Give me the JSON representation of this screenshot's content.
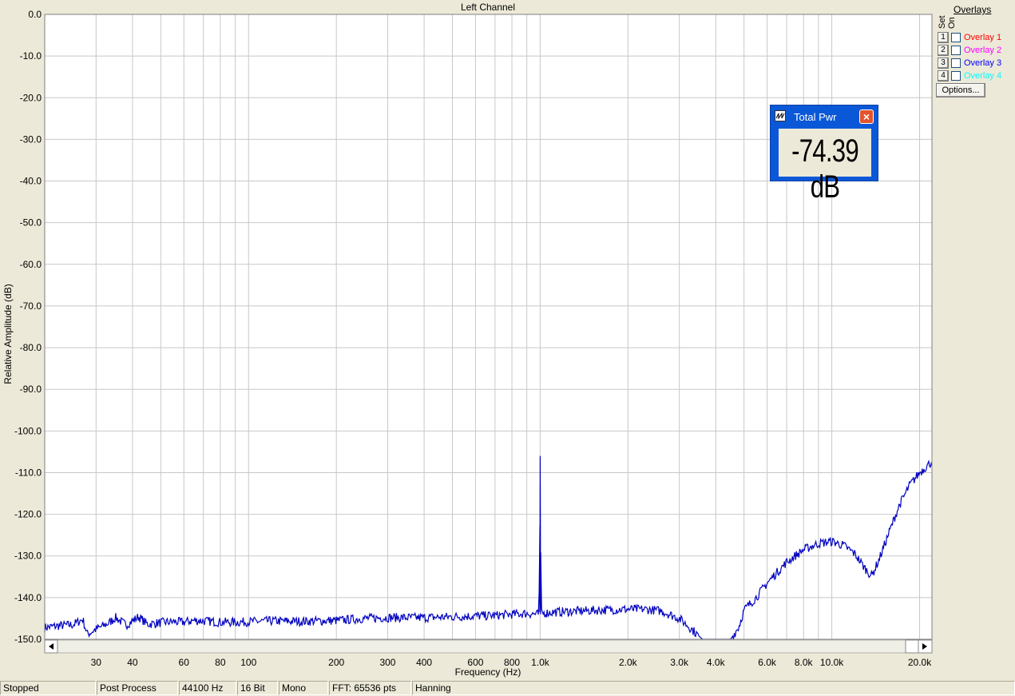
{
  "chart_data": {
    "type": "line",
    "title": "Left Channel",
    "xlabel": "Frequency (Hz)",
    "ylabel": "Relative Amplitude (dB)",
    "xscale": "log",
    "xlim": [
      20,
      22050
    ],
    "ylim": [
      -150,
      0
    ],
    "grid": true,
    "line_color": "#0000c0",
    "x_ticks": [
      {
        "v": 30,
        "label": "30"
      },
      {
        "v": 40,
        "label": "40"
      },
      {
        "v": 60,
        "label": "60"
      },
      {
        "v": 80,
        "label": "80"
      },
      {
        "v": 100,
        "label": "100"
      },
      {
        "v": 200,
        "label": "200"
      },
      {
        "v": 300,
        "label": "300"
      },
      {
        "v": 400,
        "label": "400"
      },
      {
        "v": 600,
        "label": "600"
      },
      {
        "v": 800,
        "label": "800"
      },
      {
        "v": 1000,
        "label": "1.0k"
      },
      {
        "v": 2000,
        "label": "2.0k"
      },
      {
        "v": 3000,
        "label": "3.0k"
      },
      {
        "v": 4000,
        "label": "4.0k"
      },
      {
        "v": 6000,
        "label": "6.0k"
      },
      {
        "v": 8000,
        "label": "8.0k"
      },
      {
        "v": 10000,
        "label": "10.0k"
      },
      {
        "v": 20000,
        "label": "20.0k"
      }
    ],
    "y_ticks": [
      {
        "v": 0,
        "label": "0.0"
      },
      {
        "v": -10,
        "label": "-10.0"
      },
      {
        "v": -20,
        "label": "-20.0"
      },
      {
        "v": -30,
        "label": "-30.0"
      },
      {
        "v": -40,
        "label": "-40.0"
      },
      {
        "v": -50,
        "label": "-50.0"
      },
      {
        "v": -60,
        "label": "-60.0"
      },
      {
        "v": -70,
        "label": "-70.0"
      },
      {
        "v": -80,
        "label": "-80.0"
      },
      {
        "v": -90,
        "label": "-90.0"
      },
      {
        "v": -100,
        "label": "-100.0"
      },
      {
        "v": -110,
        "label": "-110.0"
      },
      {
        "v": -120,
        "label": "-120.0"
      },
      {
        "v": -130,
        "label": "-130.0"
      },
      {
        "v": -140,
        "label": "-140.0"
      },
      {
        "v": -150,
        "label": "-150.0"
      }
    ],
    "series": [
      {
        "points": [
          [
            20,
            -147.2
          ],
          [
            22,
            -146.8
          ],
          [
            25,
            -146.5
          ],
          [
            27,
            -145.2
          ],
          [
            28,
            -148.8
          ],
          [
            30,
            -147.6
          ],
          [
            33,
            -146.2
          ],
          [
            35,
            -144.8
          ],
          [
            38,
            -146.6
          ],
          [
            40,
            -145.6
          ],
          [
            42,
            -144.6
          ],
          [
            45,
            -146.4
          ],
          [
            50,
            -146.0
          ],
          [
            55,
            -145.8
          ],
          [
            60,
            -145.9
          ],
          [
            65,
            -145.5
          ],
          [
            70,
            -145.6
          ],
          [
            80,
            -145.9
          ],
          [
            90,
            -145.9
          ],
          [
            100,
            -145.8
          ],
          [
            120,
            -145.6
          ],
          [
            150,
            -145.7
          ],
          [
            200,
            -145.5
          ],
          [
            250,
            -145.0
          ],
          [
            300,
            -144.8
          ],
          [
            400,
            -144.8
          ],
          [
            500,
            -144.6
          ],
          [
            600,
            -144.4
          ],
          [
            700,
            -144.3
          ],
          [
            800,
            -144.0
          ],
          [
            900,
            -143.8
          ],
          [
            990,
            -144.0
          ],
          [
            998,
            -125.0
          ],
          [
            1000,
            -106.0
          ],
          [
            1002,
            -122.0
          ],
          [
            1010,
            -143.8
          ],
          [
            1100,
            -143.5
          ],
          [
            1300,
            -143.3
          ],
          [
            1600,
            -143.0
          ],
          [
            2000,
            -142.8
          ],
          [
            2300,
            -142.8
          ],
          [
            2600,
            -143.2
          ],
          [
            3000,
            -145.0
          ],
          [
            3300,
            -147.5
          ],
          [
            3600,
            -150.0
          ],
          [
            4500,
            -150.0
          ],
          [
            4800,
            -147.0
          ],
          [
            5000,
            -143.0
          ],
          [
            5500,
            -140.0
          ],
          [
            6000,
            -136.5
          ],
          [
            7000,
            -131.5
          ],
          [
            8000,
            -128.5
          ],
          [
            9000,
            -127.0
          ],
          [
            10000,
            -126.5
          ],
          [
            11000,
            -127.5
          ],
          [
            12000,
            -129.5
          ],
          [
            13000,
            -133.0
          ],
          [
            13700,
            -134.8
          ],
          [
            14500,
            -131.0
          ],
          [
            15500,
            -125.5
          ],
          [
            17000,
            -118.0
          ],
          [
            18500,
            -113.0
          ],
          [
            20000,
            -110.0
          ],
          [
            21500,
            -108.0
          ],
          [
            22050,
            -107.4
          ]
        ]
      }
    ]
  },
  "overlays": {
    "title": "Overlays",
    "set_label": "Set",
    "on_label": "On",
    "items": [
      {
        "num": "1",
        "label": "Overlay 1",
        "color": "#ff0000"
      },
      {
        "num": "2",
        "label": "Overlay 2",
        "color": "#ff00ff"
      },
      {
        "num": "3",
        "label": "Overlay 3",
        "color": "#0000ff"
      },
      {
        "num": "4",
        "label": "Overlay 4",
        "color": "#00ffff"
      }
    ],
    "options_label": "Options..."
  },
  "total_power": {
    "title": "Total Pwr",
    "value": "-74.39 dB"
  },
  "status": [
    "Stopped",
    "Post Process",
    "44100 Hz",
    "16 Bit",
    "Mono",
    "FFT: 65536 pts",
    "Hanning"
  ]
}
